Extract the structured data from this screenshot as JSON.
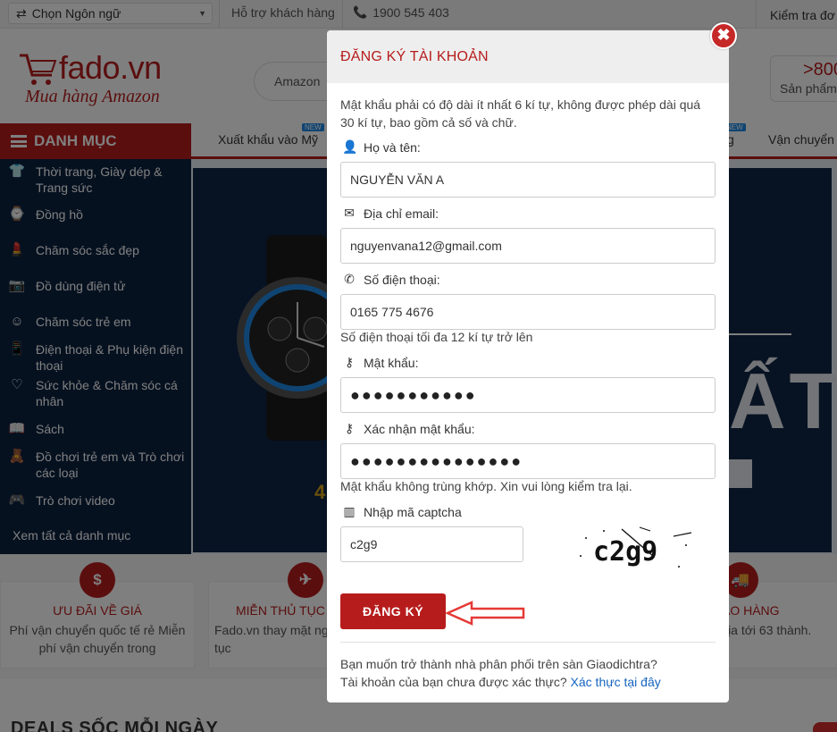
{
  "topbar": {
    "language": "Chọn Ngôn ngữ",
    "support": "Hỗ trợ khách hàng",
    "hotline": "1900 545 403",
    "track": "Kiểm tra đơ"
  },
  "header": {
    "logo_word": "fado.vn",
    "logo_slogan": "Mua hàng Amazon",
    "search_scope": "Amazon",
    "cart_count": ">800",
    "cart_label": "Sản phẩm"
  },
  "menu": {
    "title": "DANH MỤC",
    "nav_items": [
      "Xuất khẩu vào Mỹ",
      "g",
      "Vận chuyển q"
    ],
    "new_badge": "NEW",
    "sidebar": [
      "Thời trang, Giày dép & Trang sức",
      "Đồng hồ",
      "Chăm sóc sắc đẹp",
      "Đồ dùng điện tử",
      "Chăm sóc trẻ em",
      "Điện thoại & Phụ kiện điện thoại",
      "Sức khỏe & Chăm sóc cá nhân",
      "Sách",
      "Đồ chơi trẻ em và Trò chơi các loại",
      "Trò chơi video"
    ],
    "all_categories": "Xem tất cả danh mục"
  },
  "banner": {
    "text": "ẤT",
    "small_text": "4"
  },
  "features": [
    {
      "icon": "$",
      "title": "ƯU ĐÃI VỀ GIÁ",
      "desc": "Phí vận chuyển quốc tế rẻ Miễn phí vận chuyển trong"
    },
    {
      "icon": "✈",
      "title": "MIỄN THỦ TỤC",
      "desc": "Fado.vn thay mặt ng toàn bộ thủ tục"
    },
    {
      "icon": "🚚",
      "title": "Í GIAO HÀNG",
      "desc": "hàng nội địa tới 63 thành."
    }
  ],
  "deals_title": "DEALS SỐC MỖI NGÀY",
  "modal": {
    "title": "ĐĂNG KÝ TÀI KHOẢN",
    "close_symbol": "✖",
    "password_rule": "Mật khẩu phải có độ dài ít nhất 6 kí tự, không được phép dài quá 30 kí tự, bao gồm cả số và chữ.",
    "fields": {
      "name": {
        "label": "Họ và tên:",
        "value": "NGUYỄN VĂN A"
      },
      "email": {
        "label": "Địa chỉ email:",
        "value": "nguyenvana12@gmail.com"
      },
      "phone": {
        "label": "Số điện thoại:",
        "value": "0165 775 4676",
        "hint": "Số điện thoại tối đa 12 kí tự trở lên"
      },
      "password": {
        "label": "Mật khẩu:",
        "value": "●●●●●●●●●●●"
      },
      "confirm": {
        "label": "Xác nhận mật khẩu:",
        "value": "●●●●●●●●●●●●●●●",
        "hint": "Mật khẩu không trùng khớp. Xin vui lòng kiểm tra lại."
      },
      "captcha": {
        "label": "Nhập mã captcha",
        "value": "c2g9",
        "image_text": "c2g9"
      }
    },
    "submit": "ĐĂNG KÝ",
    "footer_line1": "Bạn muốn trở thành nhà phân phối trên sàn Giaodichtra?",
    "footer_line2": "Tài khoản của bạn chưa được xác thực?",
    "footer_link": "Xác thực tại đây"
  },
  "colors": {
    "brand": "#b71c1c",
    "sidebar": "#0c2340",
    "link": "#1565c0"
  }
}
